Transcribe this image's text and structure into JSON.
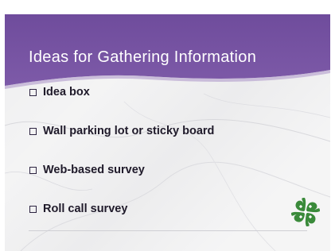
{
  "slide": {
    "title": "Ideas for Gathering Information",
    "items": [
      {
        "label": "Idea box"
      },
      {
        "label": "Wall parking lot or sticky board"
      },
      {
        "label": "Web-based survey"
      },
      {
        "label": "Roll call survey"
      }
    ],
    "logo_icon": "four-leaf-clover-icon",
    "checkbox_icon": "empty-checkbox-icon"
  },
  "colors": {
    "header_purple": "#7a56a3",
    "header_dark": "#5d3f86",
    "clover_green": "#3a8a3a",
    "text_dark": "#1f1a2a"
  }
}
